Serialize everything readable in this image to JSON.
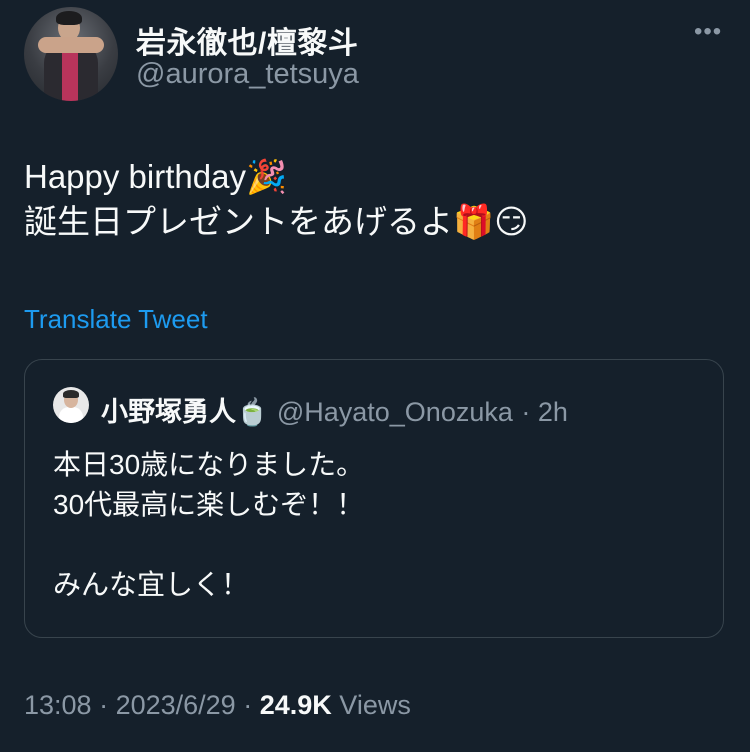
{
  "author": {
    "display_name": "岩永徹也/檀黎斗",
    "handle": "@aurora_tetsuya"
  },
  "more_label": "•••",
  "tweet": {
    "line1": "Happy birthday",
    "line1_emoji": "🎉",
    "line2": "誕生日プレゼントをあげるよ",
    "line2_emoji_gift": "🎁",
    "line2_emoji_face": "😏"
  },
  "translate_label": "Translate Tweet",
  "quote": {
    "name": "小野塚勇人",
    "name_emoji": "🍵",
    "handle": "@Hayato_Onozuka",
    "time": "· 2h",
    "lines": [
      "本日30歳になりました。",
      "30代最高に楽しむぞ！！",
      "",
      "みんな宜しく！"
    ]
  },
  "meta": {
    "time": "13:08",
    "date": "· 2023/6/29 ·",
    "views_count": "24.9K",
    "views_label": "Views"
  },
  "colors": {
    "background": "#15202b",
    "text": "#f7f9f9",
    "secondary": "#8b98a5",
    "link": "#1d9bf0",
    "border": "#38444d"
  }
}
